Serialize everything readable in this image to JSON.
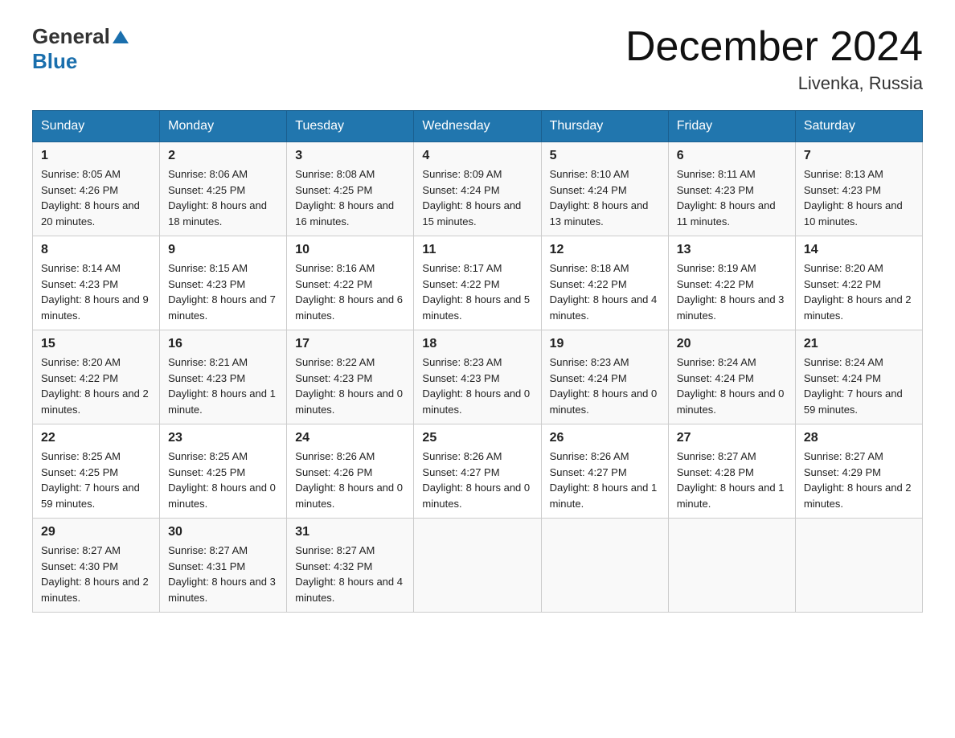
{
  "header": {
    "logo_general": "General",
    "logo_blue": "Blue",
    "month_year": "December 2024",
    "location": "Livenka, Russia"
  },
  "days_of_week": [
    "Sunday",
    "Monday",
    "Tuesday",
    "Wednesday",
    "Thursday",
    "Friday",
    "Saturday"
  ],
  "weeks": [
    [
      {
        "day": "1",
        "sunrise": "8:05 AM",
        "sunset": "4:26 PM",
        "daylight": "8 hours and 20 minutes."
      },
      {
        "day": "2",
        "sunrise": "8:06 AM",
        "sunset": "4:25 PM",
        "daylight": "8 hours and 18 minutes."
      },
      {
        "day": "3",
        "sunrise": "8:08 AM",
        "sunset": "4:25 PM",
        "daylight": "8 hours and 16 minutes."
      },
      {
        "day": "4",
        "sunrise": "8:09 AM",
        "sunset": "4:24 PM",
        "daylight": "8 hours and 15 minutes."
      },
      {
        "day": "5",
        "sunrise": "8:10 AM",
        "sunset": "4:24 PM",
        "daylight": "8 hours and 13 minutes."
      },
      {
        "day": "6",
        "sunrise": "8:11 AM",
        "sunset": "4:23 PM",
        "daylight": "8 hours and 11 minutes."
      },
      {
        "day": "7",
        "sunrise": "8:13 AM",
        "sunset": "4:23 PM",
        "daylight": "8 hours and 10 minutes."
      }
    ],
    [
      {
        "day": "8",
        "sunrise": "8:14 AM",
        "sunset": "4:23 PM",
        "daylight": "8 hours and 9 minutes."
      },
      {
        "day": "9",
        "sunrise": "8:15 AM",
        "sunset": "4:23 PM",
        "daylight": "8 hours and 7 minutes."
      },
      {
        "day": "10",
        "sunrise": "8:16 AM",
        "sunset": "4:22 PM",
        "daylight": "8 hours and 6 minutes."
      },
      {
        "day": "11",
        "sunrise": "8:17 AM",
        "sunset": "4:22 PM",
        "daylight": "8 hours and 5 minutes."
      },
      {
        "day": "12",
        "sunrise": "8:18 AM",
        "sunset": "4:22 PM",
        "daylight": "8 hours and 4 minutes."
      },
      {
        "day": "13",
        "sunrise": "8:19 AM",
        "sunset": "4:22 PM",
        "daylight": "8 hours and 3 minutes."
      },
      {
        "day": "14",
        "sunrise": "8:20 AM",
        "sunset": "4:22 PM",
        "daylight": "8 hours and 2 minutes."
      }
    ],
    [
      {
        "day": "15",
        "sunrise": "8:20 AM",
        "sunset": "4:22 PM",
        "daylight": "8 hours and 2 minutes."
      },
      {
        "day": "16",
        "sunrise": "8:21 AM",
        "sunset": "4:23 PM",
        "daylight": "8 hours and 1 minute."
      },
      {
        "day": "17",
        "sunrise": "8:22 AM",
        "sunset": "4:23 PM",
        "daylight": "8 hours and 0 minutes."
      },
      {
        "day": "18",
        "sunrise": "8:23 AM",
        "sunset": "4:23 PM",
        "daylight": "8 hours and 0 minutes."
      },
      {
        "day": "19",
        "sunrise": "8:23 AM",
        "sunset": "4:24 PM",
        "daylight": "8 hours and 0 minutes."
      },
      {
        "day": "20",
        "sunrise": "8:24 AM",
        "sunset": "4:24 PM",
        "daylight": "8 hours and 0 minutes."
      },
      {
        "day": "21",
        "sunrise": "8:24 AM",
        "sunset": "4:24 PM",
        "daylight": "7 hours and 59 minutes."
      }
    ],
    [
      {
        "day": "22",
        "sunrise": "8:25 AM",
        "sunset": "4:25 PM",
        "daylight": "7 hours and 59 minutes."
      },
      {
        "day": "23",
        "sunrise": "8:25 AM",
        "sunset": "4:25 PM",
        "daylight": "8 hours and 0 minutes."
      },
      {
        "day": "24",
        "sunrise": "8:26 AM",
        "sunset": "4:26 PM",
        "daylight": "8 hours and 0 minutes."
      },
      {
        "day": "25",
        "sunrise": "8:26 AM",
        "sunset": "4:27 PM",
        "daylight": "8 hours and 0 minutes."
      },
      {
        "day": "26",
        "sunrise": "8:26 AM",
        "sunset": "4:27 PM",
        "daylight": "8 hours and 1 minute."
      },
      {
        "day": "27",
        "sunrise": "8:27 AM",
        "sunset": "4:28 PM",
        "daylight": "8 hours and 1 minute."
      },
      {
        "day": "28",
        "sunrise": "8:27 AM",
        "sunset": "4:29 PM",
        "daylight": "8 hours and 2 minutes."
      }
    ],
    [
      {
        "day": "29",
        "sunrise": "8:27 AM",
        "sunset": "4:30 PM",
        "daylight": "8 hours and 2 minutes."
      },
      {
        "day": "30",
        "sunrise": "8:27 AM",
        "sunset": "4:31 PM",
        "daylight": "8 hours and 3 minutes."
      },
      {
        "day": "31",
        "sunrise": "8:27 AM",
        "sunset": "4:32 PM",
        "daylight": "8 hours and 4 minutes."
      },
      null,
      null,
      null,
      null
    ]
  ],
  "labels": {
    "sunrise": "Sunrise:",
    "sunset": "Sunset:",
    "daylight": "Daylight:"
  }
}
